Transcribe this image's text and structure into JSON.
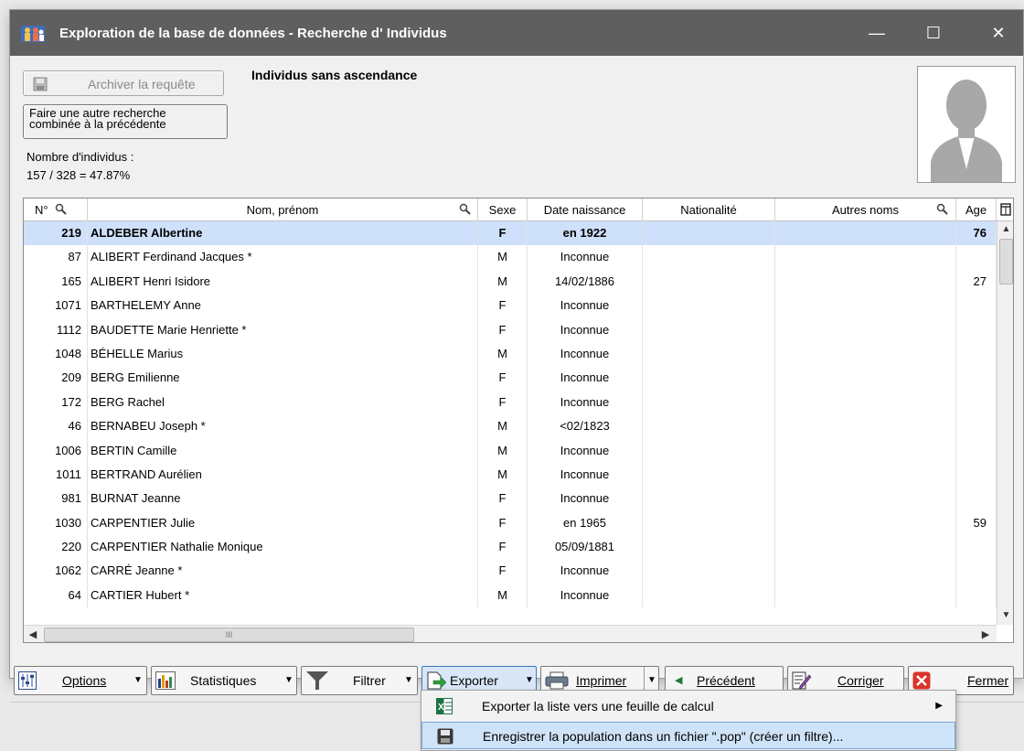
{
  "window": {
    "title": "Exploration de la base de données - Recherche d' Individus",
    "controls": {
      "minimize": "—",
      "maximize": "☐",
      "close": "✕"
    }
  },
  "header": {
    "archive_button": "Archiver la requête",
    "combine_button_line1": "Faire une autre recherche",
    "combine_button_line2": "combinée à la précédente",
    "query_title": "Individus sans ascendance",
    "count_label": "Nombre d'individus :",
    "count_value": "157 / 328  = 47.87%"
  },
  "table": {
    "columns": {
      "num": "N°",
      "name": "Nom, prénom",
      "sex": "Sexe",
      "birth": "Date naissance",
      "nationality": "Nationalité",
      "other_names": "Autres noms",
      "age": "Age"
    },
    "rows": [
      {
        "num": "219",
        "name": "ALDEBER Albertine",
        "sex": "F",
        "birth": "en 1922",
        "nationality": "",
        "other": "",
        "age": "76",
        "selected": true
      },
      {
        "num": "87",
        "name": "ALIBERT Ferdinand Jacques  *",
        "sex": "M",
        "birth": "Inconnue",
        "nationality": "",
        "other": "",
        "age": ""
      },
      {
        "num": "165",
        "name": "ALIBERT Henri Isidore",
        "sex": "M",
        "birth": "14/02/1886",
        "nationality": "",
        "other": "",
        "age": "27"
      },
      {
        "num": "1071",
        "name": "BARTHELEMY Anne",
        "sex": "F",
        "birth": "Inconnue",
        "nationality": "",
        "other": "",
        "age": ""
      },
      {
        "num": "1112",
        "name": "BAUDETTE Marie Henriette  *",
        "sex": "F",
        "birth": "Inconnue",
        "nationality": "",
        "other": "",
        "age": ""
      },
      {
        "num": "1048",
        "name": "BÉHELLE Marius",
        "sex": "M",
        "birth": "Inconnue",
        "nationality": "",
        "other": "",
        "age": ""
      },
      {
        "num": "209",
        "name": "BERG Emilienne",
        "sex": "F",
        "birth": "Inconnue",
        "nationality": "",
        "other": "",
        "age": ""
      },
      {
        "num": "172",
        "name": "BERG Rachel",
        "sex": "F",
        "birth": "Inconnue",
        "nationality": "",
        "other": "",
        "age": ""
      },
      {
        "num": "46",
        "name": "BERNABEU Joseph  *",
        "sex": "M",
        "birth": "<02/1823",
        "nationality": "",
        "other": "",
        "age": ""
      },
      {
        "num": "1006",
        "name": "BERTIN Camille",
        "sex": "M",
        "birth": "Inconnue",
        "nationality": "",
        "other": "",
        "age": ""
      },
      {
        "num": "1011",
        "name": "BERTRAND Aurélien",
        "sex": "M",
        "birth": "Inconnue",
        "nationality": "",
        "other": "",
        "age": ""
      },
      {
        "num": "981",
        "name": "BURNAT Jeanne",
        "sex": "F",
        "birth": "Inconnue",
        "nationality": "",
        "other": "",
        "age": ""
      },
      {
        "num": "1030",
        "name": "CARPENTIER Julie",
        "sex": "F",
        "birth": "en 1965",
        "nationality": "",
        "other": "",
        "age": "59"
      },
      {
        "num": "220",
        "name": "CARPENTIER Nathalie Monique",
        "sex": "F",
        "birth": "05/09/1881",
        "nationality": "",
        "other": "",
        "age": ""
      },
      {
        "num": "1062",
        "name": "CARRÉ Jeanne  *",
        "sex": "F",
        "birth": "Inconnue",
        "nationality": "",
        "other": "",
        "age": ""
      },
      {
        "num": "64",
        "name": "CARTIER Hubert  *",
        "sex": "M",
        "birth": "Inconnue",
        "nationality": "",
        "other": "",
        "age": ""
      }
    ],
    "hscroll_grip": "III"
  },
  "toolbar": {
    "options": "Options",
    "statistics": "Statistiques",
    "filter": "Filtrer",
    "export": "Exporter",
    "print": "Imprimer",
    "previous": "Précédent",
    "correct": "Corriger",
    "close": "Fermer"
  },
  "export_menu": {
    "items": [
      {
        "label": "Exporter la liste vers une feuille de calcul",
        "icon": "spreadsheet-icon",
        "has_submenu": true
      },
      {
        "label": "Enregistrer la population dans un fichier \".pop\" (créer un filtre)...",
        "icon": "save-disk-icon",
        "has_submenu": false
      }
    ]
  },
  "colors": {
    "titlebar": "#5f5f5f",
    "selected_row": "#cfe0fa",
    "menu_hover": "#cfe3f8",
    "close_red": "#d9342b"
  }
}
